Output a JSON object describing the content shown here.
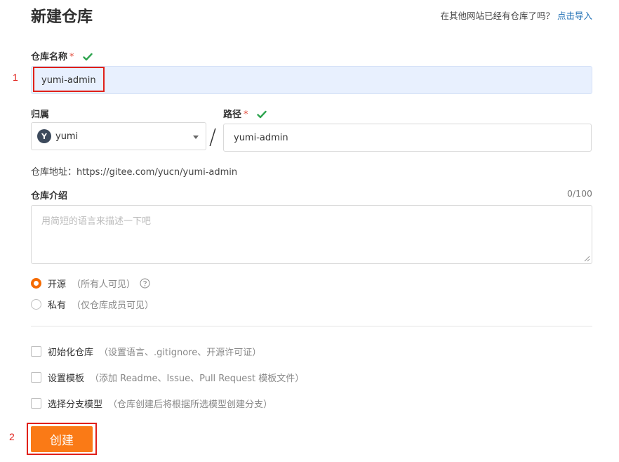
{
  "header": {
    "title": "新建仓库",
    "import_hint": "在其他网站已经有仓库了吗？",
    "import_link": "点击导入"
  },
  "repo_name": {
    "label": "仓库名称",
    "required_mark": "*",
    "value": "yumi-admin",
    "valid": true
  },
  "owner": {
    "label": "归属",
    "avatar_letter": "Y",
    "value": "yumi"
  },
  "separator": "/",
  "path": {
    "label": "路径",
    "required_mark": "*",
    "value": "yumi-admin",
    "valid": true
  },
  "address": {
    "text": "仓库地址：https://gitee.com/yucn/yumi-admin"
  },
  "description": {
    "label": "仓库介绍",
    "counter": "0/100",
    "placeholder": "用简短的语言来描述一下吧"
  },
  "visibility": {
    "options": [
      {
        "label": "开源",
        "note": "（所有人可见）",
        "selected": true
      },
      {
        "label": "私有",
        "note": "（仅仓库成员可见）",
        "selected": false
      }
    ]
  },
  "extras": [
    {
      "label": "初始化仓库",
      "note": "（设置语言、.gitignore、开源许可证）",
      "checked": false
    },
    {
      "label": "设置模板",
      "note": "（添加 Readme、Issue、Pull Request 模板文件）",
      "checked": false
    },
    {
      "label": "选择分支模型",
      "note": "（仓库创建后将根据所选模型创建分支）",
      "checked": false
    }
  ],
  "create_button": {
    "label": "创建"
  },
  "annotations": [
    "1",
    "2"
  ],
  "colors": {
    "accent": "#fa7a16",
    "link": "#1f6fb5",
    "valid": "#2ea44f",
    "annotation": "#e0201a",
    "filled_input": "#e8f0fe"
  }
}
